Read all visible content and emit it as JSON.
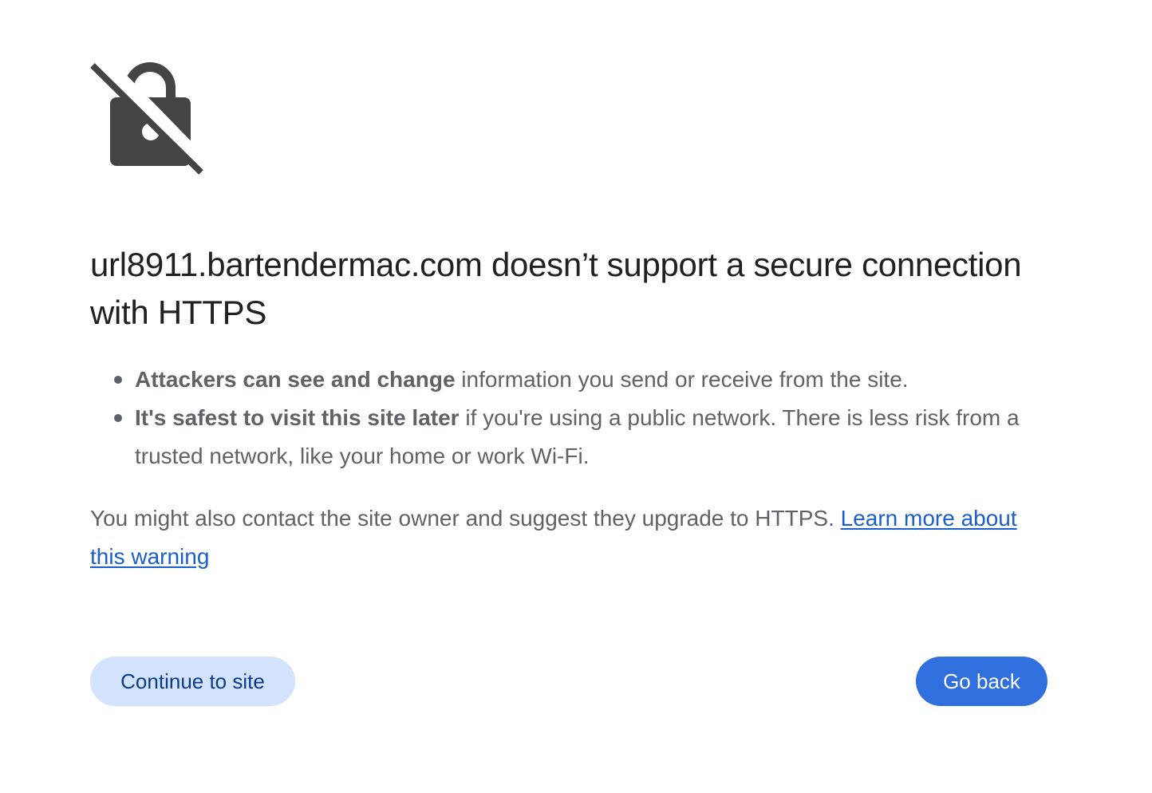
{
  "icon": "unlocked-padlock-slash-icon",
  "colors": {
    "heading": "#202124",
    "body": "#5f6368",
    "link": "#1a5fd0",
    "primary_button": "#2f6fde",
    "secondary_button": "#d3e3fd",
    "secondary_button_text": "#0b3b8c",
    "icon": "#444444"
  },
  "heading": "url8911.bartendermac.com doesn’t support a secure connection with HTTPS",
  "bullets": [
    {
      "bold": "Attackers can see and change",
      "text": " information you send or receive from the site."
    },
    {
      "bold": "It's safest to visit this site later",
      "text": " if you're using a public network. There is less risk from a trusted network, like your home or work Wi-Fi."
    }
  ],
  "note": {
    "text": "You might also contact the site owner and suggest they upgrade to HTTPS. ",
    "link": "Learn more about this warning"
  },
  "buttons": {
    "continue": "Continue to site",
    "back": "Go back"
  }
}
